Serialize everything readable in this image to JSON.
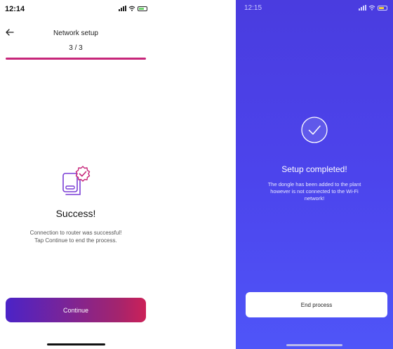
{
  "left_screen": {
    "status": {
      "time": "12:14"
    },
    "header": {
      "title": "Network setup",
      "step": "3 / 3",
      "progress": 1.0
    },
    "content": {
      "title": "Success!",
      "message_lines": [
        "Connection to router was successful!",
        "Tap Continue to end the process."
      ]
    },
    "continue_label": "Continue",
    "colors": {
      "progress": "#c7267a",
      "button_start": "#4b23c7",
      "button_end": "#cc2158"
    },
    "icons": {
      "back": "arrow-left-icon",
      "success": "device-check-icon"
    }
  },
  "right_screen": {
    "status": {
      "time": "12:15"
    },
    "content": {
      "title": "Setup completed!",
      "message_lines": [
        "The dongle has been added to the plant",
        "however is not connected to the Wi-Fi",
        "network!"
      ]
    },
    "end_label": "End process",
    "colors": {
      "background": "#4c44ec",
      "button": "#ffffff"
    },
    "icons": {
      "check": "check-circle-icon"
    }
  }
}
